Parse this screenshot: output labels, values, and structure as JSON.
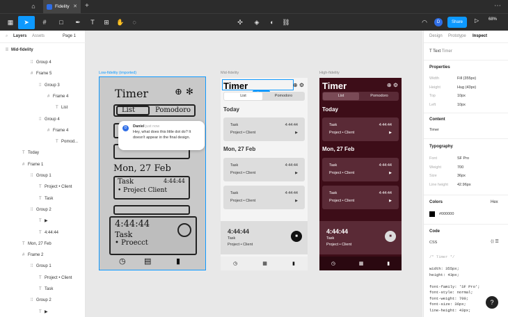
{
  "titlebar": {
    "file_name": "Fidelity",
    "close": "✕",
    "new_tab": "+",
    "more": "⋯"
  },
  "toolbar": {
    "share_label": "Share",
    "zoom": "68%",
    "avatar_initial": "D"
  },
  "left_panel": {
    "tab_layers": "Layers",
    "tab_assets": "Assets",
    "page": "Page 1",
    "page_name": "Mid-fidelity",
    "layers": [
      {
        "label": "Group 4",
        "glyph": "⁞⁞"
      },
      {
        "label": "Frame 5",
        "glyph": "#"
      },
      {
        "label": "Group 3",
        "glyph": "⁞⁞"
      },
      {
        "label": "Frame 4",
        "glyph": "#"
      },
      {
        "label": "List",
        "glyph": "T"
      },
      {
        "label": "Group 4",
        "glyph": "⁞⁞"
      },
      {
        "label": "Frame 4",
        "glyph": "#"
      },
      {
        "label": "Pomod...",
        "glyph": "T"
      },
      {
        "label": "Today",
        "glyph": "T"
      },
      {
        "label": "Frame 1",
        "glyph": "#"
      },
      {
        "label": "Group 1",
        "glyph": "⁞⁞"
      },
      {
        "label": "Project • Client",
        "glyph": "T"
      },
      {
        "label": "Task",
        "glyph": "T"
      },
      {
        "label": "Group 2",
        "glyph": "⁞⁞"
      },
      {
        "label": "▶",
        "glyph": "T"
      },
      {
        "label": "4:44:44",
        "glyph": "T"
      },
      {
        "label": "Mon, 27 Feb",
        "glyph": "T"
      },
      {
        "label": "Frame 2",
        "glyph": "#"
      },
      {
        "label": "Group 1",
        "glyph": "⁞⁞"
      },
      {
        "label": "Project • Client",
        "glyph": "T"
      },
      {
        "label": "Task",
        "glyph": "T"
      },
      {
        "label": "Group 2",
        "glyph": "⁞⁞"
      },
      {
        "label": "▶",
        "glyph": "T"
      }
    ]
  },
  "canvas": {
    "label_low": "Low-fidelity (imported)",
    "label_mid": "Mid-fidelity",
    "label_high": "High-fidelity",
    "fill_hug": "Fill × Hug",
    "sketch": {
      "title": "Timer",
      "tab_list": "List",
      "tab_pomodoro": "Pomodoro",
      "date": "Mon, 27 Feb",
      "task": "Task",
      "time": "4:44:44",
      "project": "• Project Client",
      "timer": "4:44:44",
      "timer_task": "Task",
      "timer_project": "• Proecct"
    },
    "app": {
      "title": "Timer",
      "tab_list": "List",
      "tab_pomodoro": "Pomodoro",
      "today": "Today",
      "date": "Mon, 27 Feb",
      "task": "Task",
      "project": "Project • Client",
      "time": "4:44:44",
      "timer_time": "4:44:44",
      "timer_task": "Task",
      "timer_project": "Project • Client"
    },
    "comment": {
      "author": "Daniel",
      "when": "just now",
      "avatar": "D",
      "message": "Hey, what does this little dot do? It doesn't appear in the final design."
    }
  },
  "right_panel": {
    "tab_design": "Design",
    "tab_prototype": "Prototype",
    "tab_inspect": "Inspect",
    "layer_type": "Text",
    "layer_name": "Timer",
    "properties_heading": "Properties",
    "props": [
      {
        "k": "Width",
        "v": "Fill (355px)"
      },
      {
        "k": "Height",
        "v": "Hug (43px)"
      },
      {
        "k": "Top",
        "v": "10px"
      },
      {
        "k": "Left",
        "v": "10px"
      }
    ],
    "content_heading": "Content",
    "content": "Timer",
    "typography_heading": "Typography",
    "typo": [
      {
        "k": "Font",
        "v": "SF Pro"
      },
      {
        "k": "Weight",
        "v": "700"
      },
      {
        "k": "Size",
        "v": "36px"
      },
      {
        "k": "Line height",
        "v": "42.96px"
      }
    ],
    "colors_heading": "Colors",
    "color_mode": "Hex",
    "color_value": "#000000",
    "code_heading": "Code",
    "code_lang": "CSS",
    "code_lines": [
      "/* Timer */",
      "",
      "width: 355px;",
      "height: 43px;",
      "",
      "font-family: 'SF Pro';",
      "font-style: normal;",
      "font-weight: 700;",
      "font-size: 36px;",
      "line-height: 43px;"
    ],
    "help": "?"
  },
  "colors": {
    "accent": "#0d99ff",
    "hi_bg": "#3d0d18",
    "hi_card": "#5a2a36"
  }
}
